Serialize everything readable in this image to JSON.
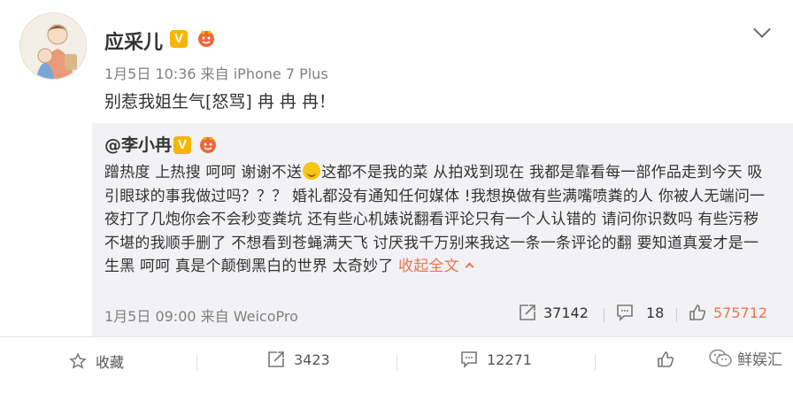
{
  "post": {
    "author": "应采儿",
    "meta": "1月5日 10:36 来自 iPhone 7 Plus",
    "text": "别惹我姐生气[怒骂] 冉 冉 冉！"
  },
  "quoted": {
    "author": "@李小冉",
    "body_part1": "蹭热度 上热搜 呵呵 谢谢不送",
    "body_part2": "这都不是我的菜 从拍戏到现在 我都是靠看每一部作品走到今天 吸引眼球的事我做过吗？？？ 婚礼都没有通知任何媒体 !我想换做有些满嘴喷粪的人 你被人无端问一夜打了几炮你会不会秒变粪坑 还有些心机婊说翻看评论只有一个人认错的 请问你识数吗 有些污秽不堪的我顺手删了 不想看到苍蝇满天飞 讨厌我千万别来我这一条一条评论的翻 要知道真爱才是一生黑 呵呵 真是个颠倒黑白的世界 太奇妙了 ",
    "collapse_label": "收起全文",
    "meta": "1月5日 09:00 来自 WeicoPro",
    "reposts": "37142",
    "comments": "18",
    "likes": "575712"
  },
  "actions": {
    "favorite": "收藏",
    "reposts": "3423",
    "comments": "12271"
  },
  "watermark": "鲜娱汇",
  "colors": {
    "accent": "#eb7350",
    "badge": "#f7b500",
    "quote_bg": "#f2f2f5"
  }
}
